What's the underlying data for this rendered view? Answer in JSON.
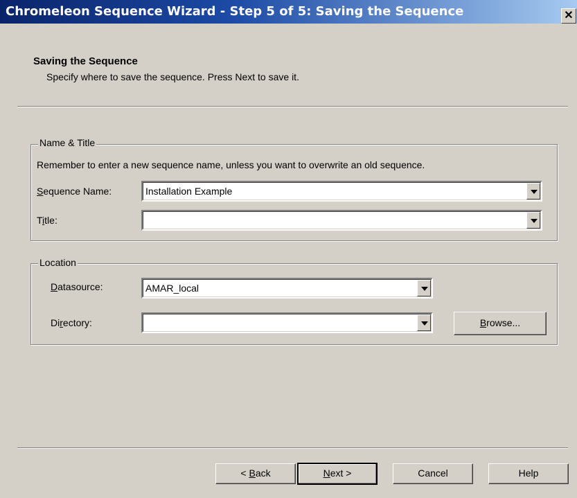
{
  "window": {
    "title": "Chromeleon Sequence Wizard - Step 5 of 5: Saving the Sequence",
    "close_glyph": "✕"
  },
  "header": {
    "title": "Saving the Sequence",
    "subtitle": "Specify where to save the sequence. Press Next to save it."
  },
  "name_title_group": {
    "legend": "Name & Title",
    "hint": "Remember to enter a new sequence name, unless you want to overwrite an old sequence.",
    "sequence_name_label": "Sequence Name:",
    "sequence_name_value": "Installation Example",
    "title_label": "Title:",
    "title_value": ""
  },
  "location_group": {
    "legend": "Location",
    "datasource_label": "Datasource:",
    "datasource_value": "AMAR_local",
    "directory_label": "Directory:",
    "directory_value": "",
    "browse_label": "Browse..."
  },
  "buttons": {
    "back": "< Back",
    "next": "Next >",
    "cancel": "Cancel",
    "help": "Help"
  },
  "icons": {
    "dropdown": "chevron-down-icon",
    "close": "close-icon"
  }
}
